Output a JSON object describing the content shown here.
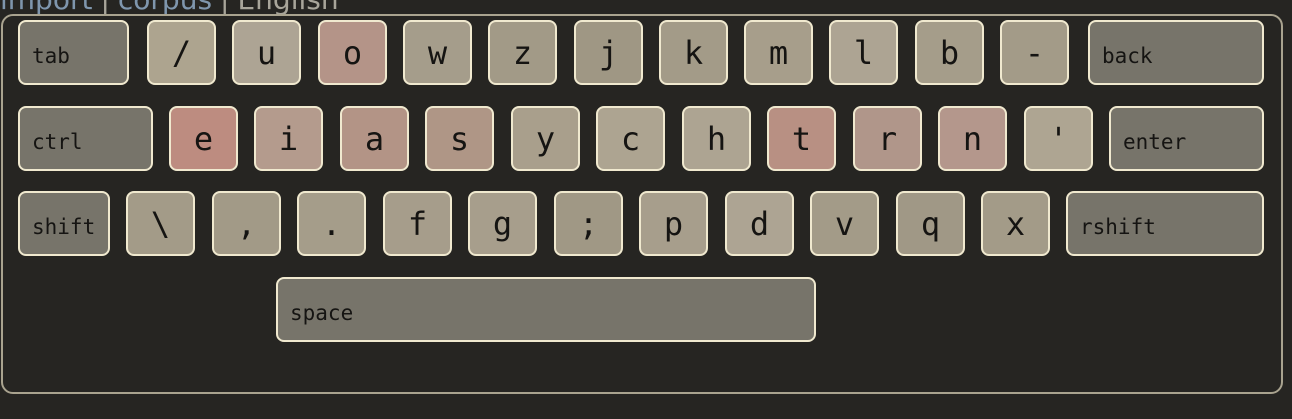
{
  "topbar": {
    "import_label": "import",
    "separator": "|",
    "corpus_label": "corpus",
    "language_label": "English"
  },
  "keyboard": {
    "rows": [
      [
        {
          "id": "tab",
          "label": "tab",
          "modifier": true
        },
        {
          "id": "slash",
          "label": "/",
          "color": "#ada48f"
        },
        {
          "id": "u",
          "label": "u",
          "color": "#ada494"
        },
        {
          "id": "o",
          "label": "o",
          "color": "#b49488"
        },
        {
          "id": "w",
          "label": "w",
          "color": "#a59d8b"
        },
        {
          "id": "z",
          "label": "z",
          "color": "#a29a87"
        },
        {
          "id": "j",
          "label": "j",
          "color": "#9f9784"
        },
        {
          "id": "k",
          "label": "k",
          "color": "#a39b88"
        },
        {
          "id": "m",
          "label": "m",
          "color": "#a79e8b"
        },
        {
          "id": "l",
          "label": "l",
          "color": "#ada493"
        },
        {
          "id": "b",
          "label": "b",
          "color": "#a59d8a"
        },
        {
          "id": "dash",
          "label": "-",
          "color": "#a39b88"
        },
        {
          "id": "back",
          "label": "back",
          "modifier": true
        }
      ],
      [
        {
          "id": "ctrl",
          "label": "ctrl",
          "modifier": true
        },
        {
          "id": "e",
          "label": "e",
          "color": "#bd8c80"
        },
        {
          "id": "i",
          "label": "i",
          "color": "#b49b8d"
        },
        {
          "id": "a",
          "label": "a",
          "color": "#b39486"
        },
        {
          "id": "s",
          "label": "s",
          "color": "#af9686"
        },
        {
          "id": "y",
          "label": "y",
          "color": "#a99f8c"
        },
        {
          "id": "c",
          "label": "c",
          "color": "#ada491"
        },
        {
          "id": "h",
          "label": "h",
          "color": "#ada492"
        },
        {
          "id": "t",
          "label": "t",
          "color": "#b89083"
        },
        {
          "id": "r",
          "label": "r",
          "color": "#b0968a"
        },
        {
          "id": "n",
          "label": "n",
          "color": "#b4978c"
        },
        {
          "id": "apostrophe",
          "label": "'",
          "color": "#aea592"
        },
        {
          "id": "enter",
          "label": "enter",
          "modifier": true
        }
      ],
      [
        {
          "id": "shift",
          "label": "shift",
          "modifier": true
        },
        {
          "id": "backslash",
          "label": "\\",
          "color": "#a39b88"
        },
        {
          "id": "comma",
          "label": ",",
          "color": "#a29a87"
        },
        {
          "id": "period",
          "label": ".",
          "color": "#a59d8a"
        },
        {
          "id": "f",
          "label": "f",
          "color": "#a69d8b"
        },
        {
          "id": "g",
          "label": "g",
          "color": "#a79e8c"
        },
        {
          "id": "semicolon",
          "label": ";",
          "color": "#a09885"
        },
        {
          "id": "p",
          "label": "p",
          "color": "#a79e8c"
        },
        {
          "id": "d",
          "label": "d",
          "color": "#ada493"
        },
        {
          "id": "v",
          "label": "v",
          "color": "#a39b88"
        },
        {
          "id": "q",
          "label": "q",
          "color": "#a09886"
        },
        {
          "id": "x",
          "label": "x",
          "color": "#a39b88"
        },
        {
          "id": "rshift",
          "label": "rshift",
          "modifier": true
        }
      ],
      [
        {
          "id": "space",
          "label": "space",
          "modifier": true
        }
      ]
    ]
  }
}
